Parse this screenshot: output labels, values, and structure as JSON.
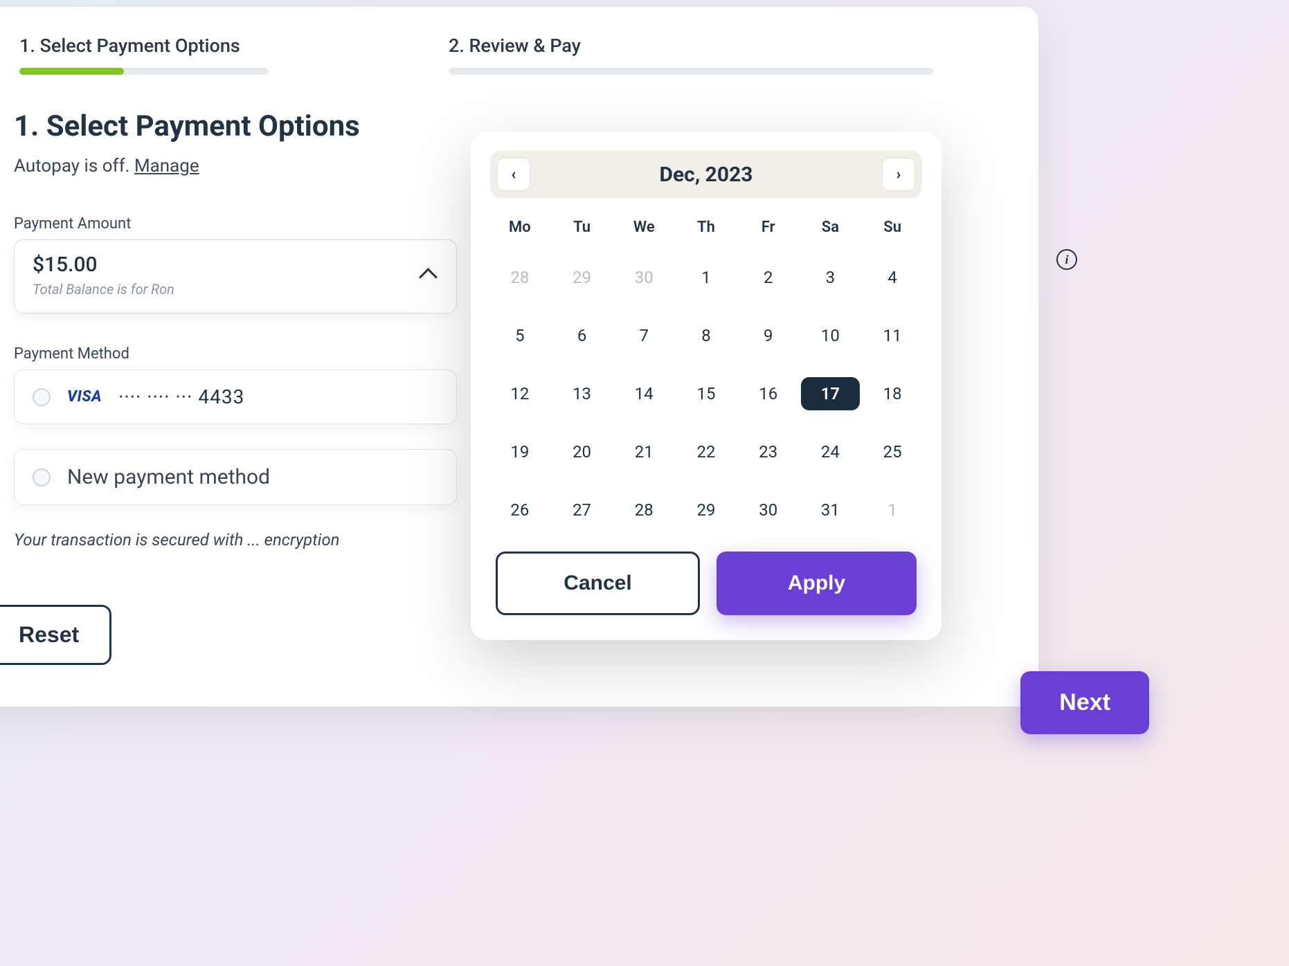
{
  "stepper": {
    "step1_label": "1. Select Payment Options",
    "step2_label": "2. Review & Pay"
  },
  "page": {
    "title": "1. Select Payment Options",
    "autopay_prefix": "Autopay is off. ",
    "autopay_manage": "Manage"
  },
  "payment_amount": {
    "label": "Payment Amount",
    "value": "$15.00",
    "subtext": "Total Balance is for Ron"
  },
  "payment_method": {
    "label": "Payment Method",
    "visa_brand": "VISA",
    "card_masked": "···· ···· ··· 4433",
    "new_method": "New payment method"
  },
  "security_note": "Your transaction is secured with ... encryption",
  "actions": {
    "reset": "Reset",
    "next": "Next"
  },
  "datepicker": {
    "title": "Dec, 2023",
    "prev_glyph": "‹",
    "next_glyph": "›",
    "dow": [
      "Mo",
      "Tu",
      "We",
      "Th",
      "Fr",
      "Sa",
      "Su"
    ],
    "days": [
      {
        "n": "28",
        "muted": true
      },
      {
        "n": "29",
        "muted": true
      },
      {
        "n": "30",
        "muted": true
      },
      {
        "n": "1"
      },
      {
        "n": "2"
      },
      {
        "n": "3"
      },
      {
        "n": "4"
      },
      {
        "n": "5"
      },
      {
        "n": "6"
      },
      {
        "n": "7"
      },
      {
        "n": "8"
      },
      {
        "n": "9"
      },
      {
        "n": "10"
      },
      {
        "n": "11"
      },
      {
        "n": "12"
      },
      {
        "n": "13"
      },
      {
        "n": "14"
      },
      {
        "n": "15"
      },
      {
        "n": "16"
      },
      {
        "n": "17",
        "selected": true
      },
      {
        "n": "18"
      },
      {
        "n": "19"
      },
      {
        "n": "20"
      },
      {
        "n": "21"
      },
      {
        "n": "22"
      },
      {
        "n": "23"
      },
      {
        "n": "24"
      },
      {
        "n": "25"
      },
      {
        "n": "26"
      },
      {
        "n": "27"
      },
      {
        "n": "28"
      },
      {
        "n": "29"
      },
      {
        "n": "30"
      },
      {
        "n": "31"
      },
      {
        "n": "1",
        "muted": true
      }
    ],
    "cancel": "Cancel",
    "apply": "Apply"
  },
  "info_glyph": "i"
}
